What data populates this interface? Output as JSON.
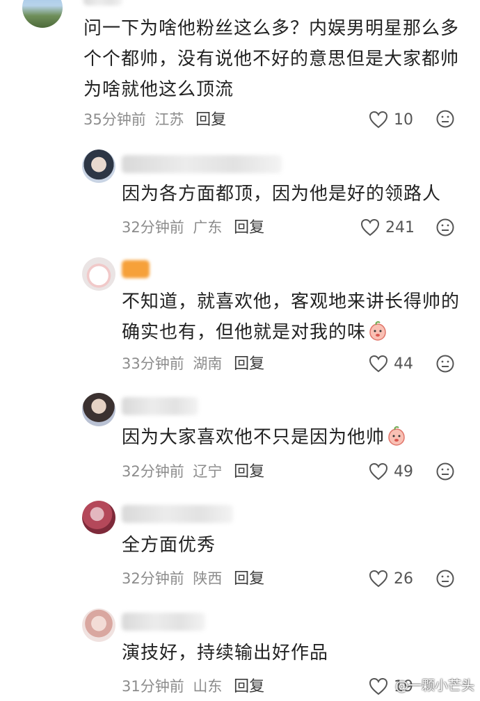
{
  "top_comment": {
    "text": "问一下为啥他粉丝这么多？内娱男明星那么多个个都帅，没有说他不好的意思但是大家都帅为啥就他这么顶流",
    "time": "35分钟前",
    "location": "江苏",
    "reply_label": "回复",
    "likes": "10"
  },
  "replies": [
    {
      "text": "因为各方面都顶，因为他是好的领路人",
      "time": "32分钟前",
      "location": "广东",
      "reply_label": "回复",
      "likes": "241"
    },
    {
      "text": "不知道，就喜欢他，客观地来讲长得帅的确实也有，但他就是对我的味",
      "time": "33分钟前",
      "location": "湖南",
      "reply_label": "回复",
      "likes": "44"
    },
    {
      "text": "因为大家喜欢他不只是因为他帅",
      "time": "32分钟前",
      "location": "辽宁",
      "reply_label": "回复",
      "likes": "49"
    },
    {
      "text": "全方面优秀",
      "time": "32分钟前",
      "location": "陕西",
      "reply_label": "回复",
      "likes": "26"
    },
    {
      "text": "演技好，持续输出好作品",
      "time": "31分钟前",
      "location": "山东",
      "reply_label": "回复",
      "likes": "19"
    }
  ],
  "watermark": "@一颗小芒头",
  "icons": {
    "like": "heart-outline-icon",
    "dislike": "frown-face-icon",
    "emoji": "peach-emoji-icon"
  }
}
